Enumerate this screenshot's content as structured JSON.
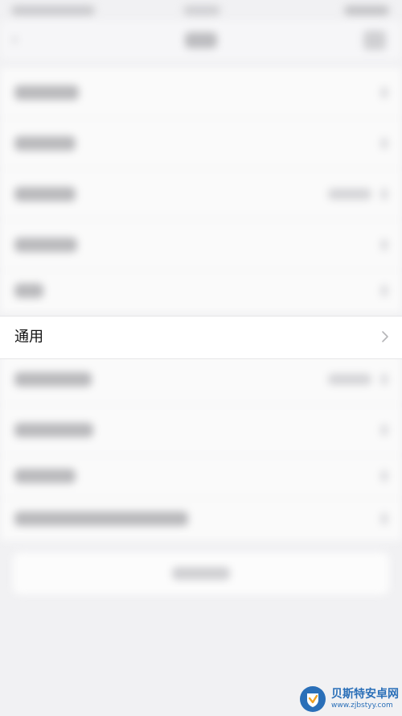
{
  "settings": {
    "general_row": {
      "label": "通用",
      "icon": "chevron-right-icon"
    }
  },
  "watermark": {
    "name": "贝斯特安卓网",
    "url": "www.zjbstyy.com",
    "brand_color": "#2a6fb8"
  }
}
